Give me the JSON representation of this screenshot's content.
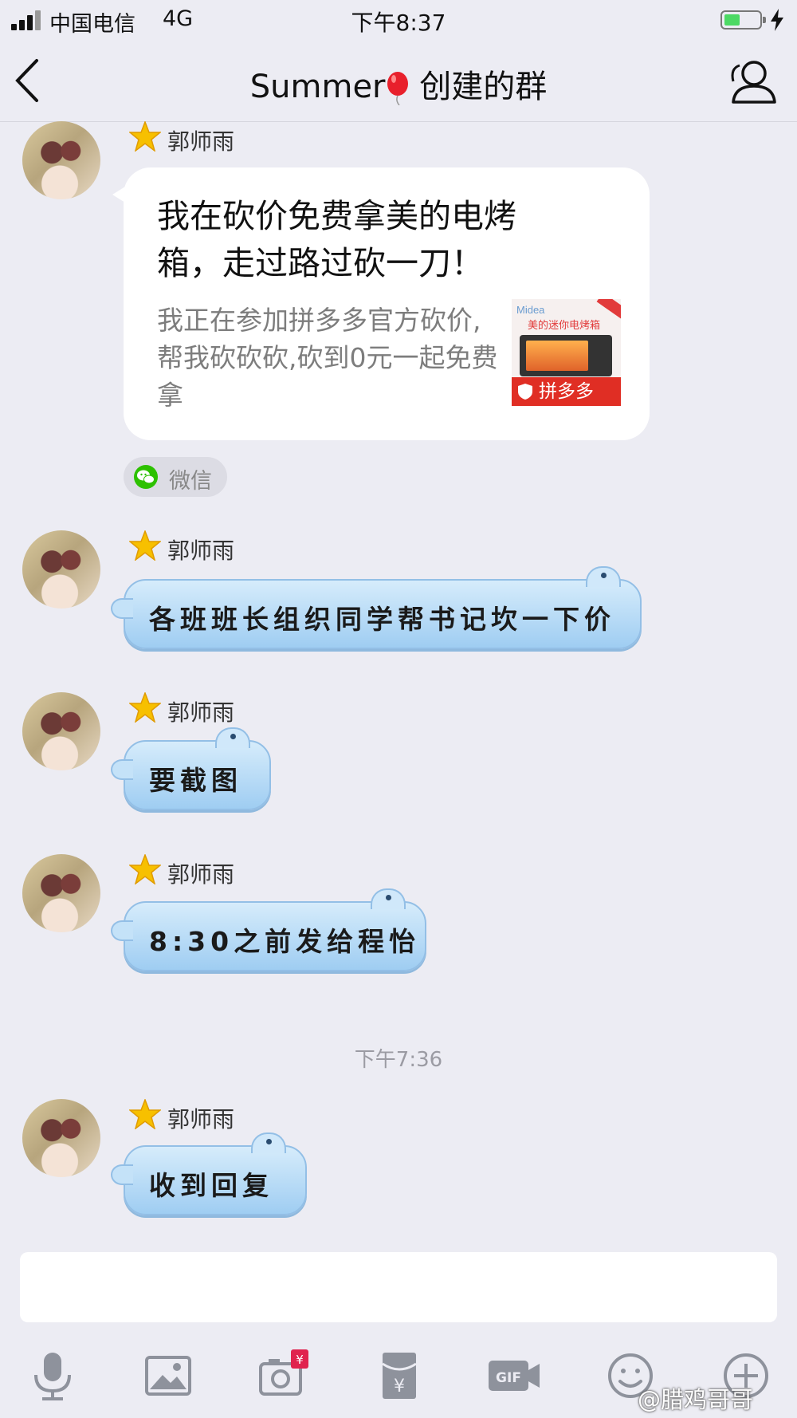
{
  "status_bar": {
    "carrier": "中国电信",
    "network": "4G",
    "time": "下午8:37",
    "battery_level": 0.45,
    "battery_color": "#4cd964"
  },
  "nav": {
    "title_prefix": "Summer",
    "title_emoji": "balloon",
    "title_suffix": " 创建的群",
    "back_icon": "chevron-left-icon",
    "members_icon": "person-icon"
  },
  "messages": [
    {
      "sender": "郭师雨",
      "type": "share_card",
      "card": {
        "title": "我在砍价免费拿美的电烤箱，走过路过砍一刀！",
        "description": "我正在参加拼多多官方砍价,帮我砍砍砍,砍到0元一起免费拿",
        "thumb_brand": "Midea",
        "thumb_product": "美的迷你电烤箱",
        "thumb_tag": "拼多多"
      },
      "source": "微信"
    },
    {
      "sender": "郭师雨",
      "type": "text",
      "text": "各班班长组织同学帮书记坎一下价"
    },
    {
      "sender": "郭师雨",
      "type": "text",
      "text": "要截图"
    },
    {
      "sender": "郭师雨",
      "type": "text",
      "text": "8:30之前发给程怡"
    },
    {
      "timestamp": "下午7:36"
    },
    {
      "sender": "郭师雨",
      "type": "text",
      "text": "收到回复"
    }
  ],
  "toolbar": {
    "icons": [
      "microphone-icon",
      "image-icon",
      "camera-redpacket-icon",
      "red-envelope-icon",
      "gif-icon",
      "emoji-icon",
      "plus-icon"
    ],
    "camera_badge": "¥",
    "envelope_symbol": "¥",
    "gif_label": "GIF"
  },
  "watermark": "@腊鸡哥哥",
  "colors": {
    "background": "#ececf3",
    "bubble_blue": "#9fcdf2",
    "pdd_red": "#e02e24",
    "wechat_green": "#2dc100",
    "star": "#f7c000"
  }
}
